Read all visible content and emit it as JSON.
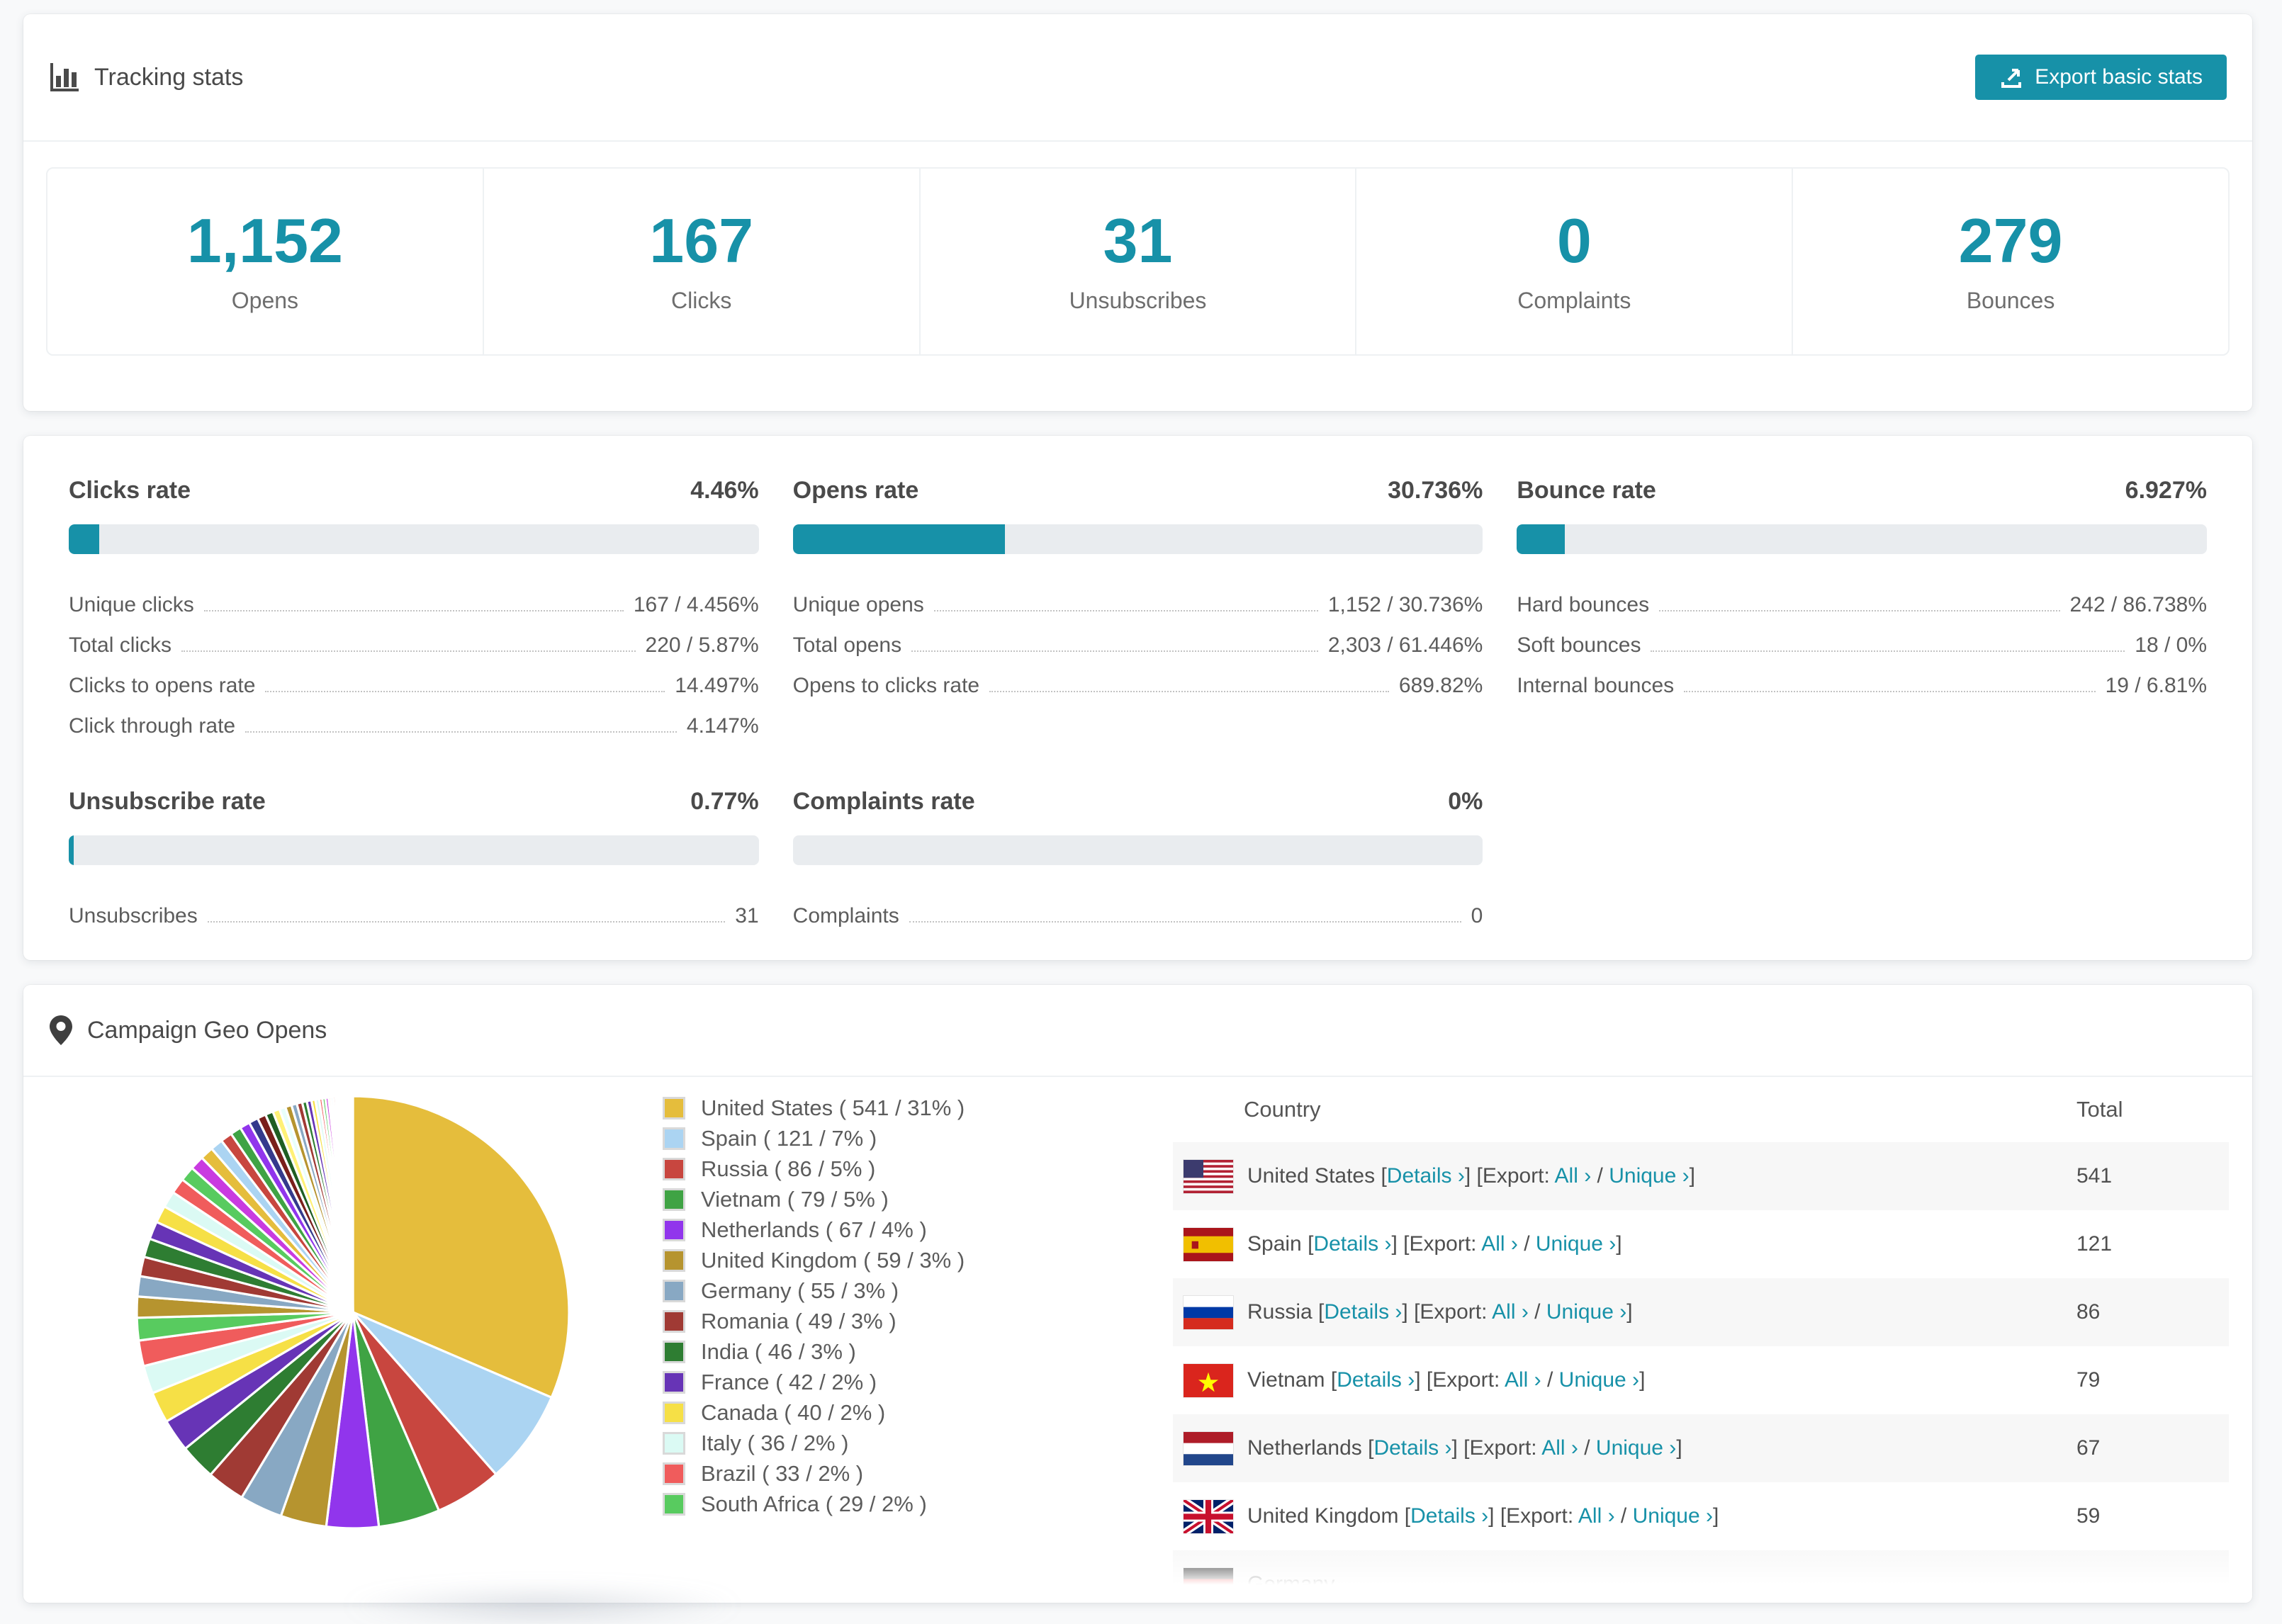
{
  "accent_color": "#1791A8",
  "page_bg": "#F8F9FA",
  "tracking": {
    "title": "Tracking stats",
    "export_button_label": "Export basic stats",
    "stats": [
      {
        "value": "1,152",
        "label": "Opens"
      },
      {
        "value": "167",
        "label": "Clicks"
      },
      {
        "value": "31",
        "label": "Unsubscribes"
      },
      {
        "value": "0",
        "label": "Complaints"
      },
      {
        "value": "279",
        "label": "Bounces"
      }
    ]
  },
  "rates": [
    {
      "title": "Clicks rate",
      "value": "4.46%",
      "bar_percent": 4.46,
      "rows": [
        {
          "label": "Unique clicks",
          "value": "167 / 4.456%"
        },
        {
          "label": "Total clicks",
          "value": "220 / 5.87%"
        },
        {
          "label": "Clicks to opens rate",
          "value": "14.497%"
        },
        {
          "label": "Click through rate",
          "value": "4.147%"
        }
      ]
    },
    {
      "title": "Opens rate",
      "value": "30.736%",
      "bar_percent": 30.736,
      "rows": [
        {
          "label": "Unique opens",
          "value": "1,152 / 30.736%"
        },
        {
          "label": "Total opens",
          "value": "2,303 / 61.446%"
        },
        {
          "label": "Opens to clicks rate",
          "value": "689.82%"
        }
      ]
    },
    {
      "title": "Bounce rate",
      "value": "6.927%",
      "bar_percent": 6.927,
      "rows": [
        {
          "label": "Hard bounces",
          "value": "242 / 86.738%"
        },
        {
          "label": "Soft bounces",
          "value": "18 / 0%"
        },
        {
          "label": "Internal bounces",
          "value": "19 / 6.81%"
        }
      ]
    },
    {
      "title": "Unsubscribe rate",
      "value": "0.77%",
      "bar_percent": 0.77,
      "rows": [
        {
          "label": "Unsubscribes",
          "value": "31"
        }
      ]
    },
    {
      "title": "Complaints rate",
      "value": "0%",
      "bar_percent": 0,
      "rows": [
        {
          "label": "Complaints",
          "value": "0"
        }
      ]
    }
  ],
  "geo": {
    "title": "Campaign Geo Opens",
    "legend_format": {
      "open": " ( ",
      "sep": " / ",
      "close": " )"
    },
    "table": {
      "columns": [
        "Country",
        "Total"
      ],
      "link_labels": {
        "details": "Details ›",
        "export_prefix": "Export:",
        "all": "All ›",
        "unique": "Unique ›"
      },
      "punctuation": {
        "open_bracket": "[",
        "close_bracket": "]",
        "separator": "/"
      },
      "rows": [
        {
          "country": "United States",
          "flag": "us",
          "total": "541"
        },
        {
          "country": "Spain",
          "flag": "es",
          "total": "121"
        },
        {
          "country": "Russia",
          "flag": "ru",
          "total": "86"
        },
        {
          "country": "Vietnam",
          "flag": "vn",
          "total": "79"
        },
        {
          "country": "Netherlands",
          "flag": "nl",
          "total": "67"
        },
        {
          "country": "United Kingdom",
          "flag": "gb",
          "total": "59"
        }
      ],
      "partial_row": {
        "country": "Germany",
        "flag": "de"
      }
    }
  },
  "chart_data": {
    "type": "pie",
    "title": "Campaign Geo Opens",
    "legend_position": "right",
    "start_angle_deg": -90,
    "direction": "clockwise",
    "series": [
      {
        "name": "United States",
        "value": 541,
        "pct": "31%",
        "color": "#E5BD3C"
      },
      {
        "name": "Spain",
        "value": 121,
        "pct": "7%",
        "color": "#ABD4F2"
      },
      {
        "name": "Russia",
        "value": 86,
        "pct": "5%",
        "color": "#C8463F"
      },
      {
        "name": "Vietnam",
        "value": 79,
        "pct": "5%",
        "color": "#3FA344"
      },
      {
        "name": "Netherlands",
        "value": 67,
        "pct": "4%",
        "color": "#9135EC"
      },
      {
        "name": "United Kingdom",
        "value": 59,
        "pct": "3%",
        "color": "#B6942F"
      },
      {
        "name": "Germany",
        "value": 55,
        "pct": "3%",
        "color": "#88A8C3"
      },
      {
        "name": "Romania",
        "value": 49,
        "pct": "3%",
        "color": "#A03A34"
      },
      {
        "name": "India",
        "value": 46,
        "pct": "3%",
        "color": "#2E7D32"
      },
      {
        "name": "France",
        "value": 42,
        "pct": "2%",
        "color": "#6734B6"
      },
      {
        "name": "Canada",
        "value": 40,
        "pct": "2%",
        "color": "#F6E046"
      },
      {
        "name": "Italy",
        "value": 36,
        "pct": "2%",
        "color": "#DBFAF4"
      },
      {
        "name": "Brazil",
        "value": 33,
        "pct": "2%",
        "color": "#F05C5C"
      },
      {
        "name": "South Africa",
        "value": 29,
        "pct": "2%",
        "color": "#58CB5F"
      }
    ],
    "other_small_slices": [
      27,
      26,
      25,
      24,
      23,
      22,
      21,
      20,
      19,
      18,
      17,
      16,
      15,
      14,
      13,
      12,
      11,
      10,
      9,
      8,
      8,
      7,
      7,
      6,
      6,
      5,
      5,
      4,
      4,
      4,
      3,
      3,
      3,
      2,
      2,
      2,
      2,
      1,
      1,
      1,
      1,
      1,
      1,
      1,
      1,
      1,
      1,
      1,
      1,
      1,
      1
    ],
    "other_slice_palette": [
      "#B6942F",
      "#88A8C3",
      "#A03A34",
      "#2E7D32",
      "#6734B6",
      "#F6E046",
      "#DBFAF4",
      "#F05C5C",
      "#58CB5F",
      "#C93BE0",
      "#E5BD3C",
      "#ABD4F2",
      "#C8463F",
      "#3FA344",
      "#9135EC",
      "#343A8C",
      "#7A1F1C",
      "#1F5E23",
      "#FFF176",
      "#E8FFFB"
    ]
  }
}
